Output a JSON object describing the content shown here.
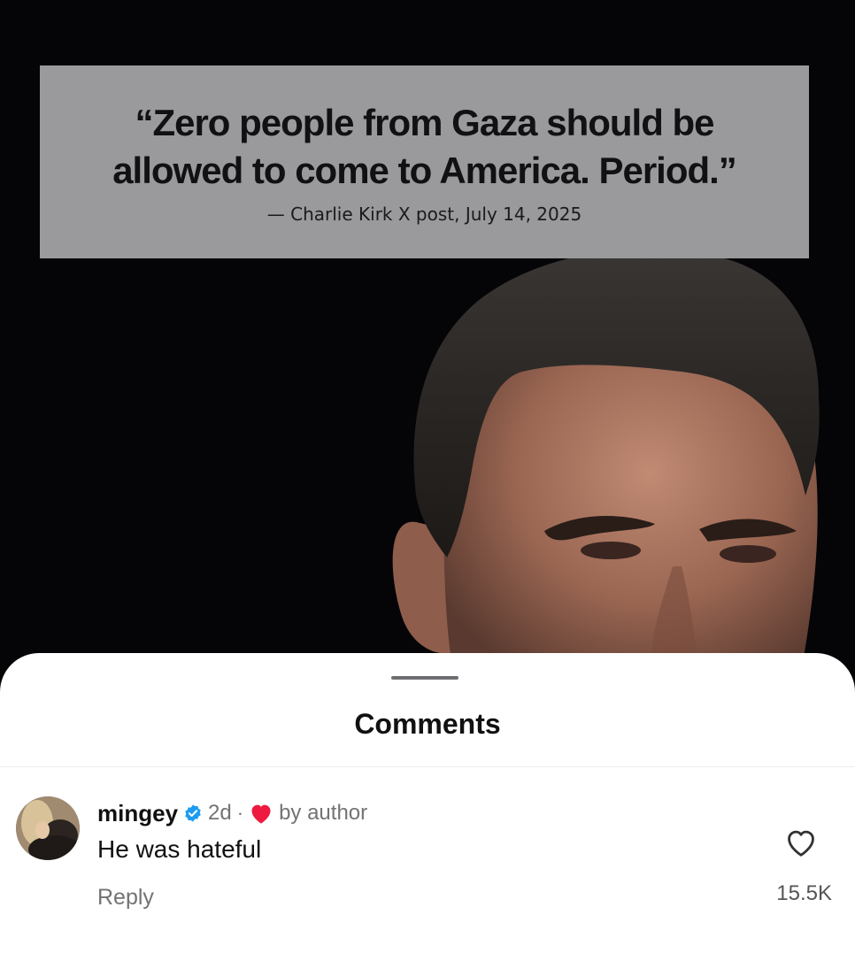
{
  "post": {
    "quote": {
      "line1": "“Zero people from Gaza should be",
      "line2": "allowed to come to America. Period.”",
      "attribution": "— Charlie Kirk X post, July 14, 2025"
    },
    "colors": {
      "background": "#050507",
      "quote_card": "#9a9a9c"
    }
  },
  "comments_sheet": {
    "title": "Comments",
    "comments": [
      {
        "username": "mingey",
        "verified": true,
        "time": "2d",
        "separator": "·",
        "liked_by_author_label": "by author",
        "text": "He was hateful",
        "reply_label": "Reply",
        "like_count": "15.5K"
      }
    ]
  },
  "icons": {
    "verified": "verified-badge-icon",
    "liked_by_author": "red-heart-icon",
    "like": "heart-outline-icon"
  },
  "colors": {
    "verified": "#1d9bf0",
    "heart": "#ee1a3f",
    "muted_text": "#737373"
  }
}
